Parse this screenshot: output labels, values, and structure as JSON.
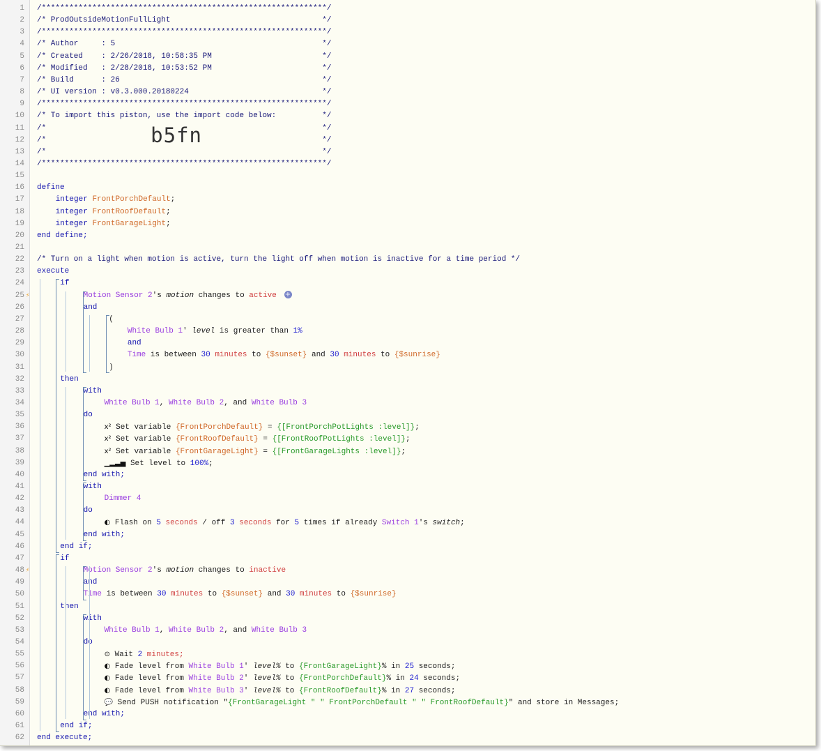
{
  "lines": [
    "/**************************************************************/",
    "/* ProdOutsideMotionFullLight                                 */",
    "/**************************************************************/",
    "/* Author     : 5                                             */",
    "/* Created    : 2/26/2018, 10:58:35 PM                        */",
    "/* Modified   : 2/28/2018, 10:53:52 PM                        */",
    "/* Build      : 26                                            */",
    "/* UI version : v0.3.000.20180224                             */",
    "/**************************************************************/",
    "/* To import this piston, use the import code below:          */",
    "/*                                                            */",
    "/*                                                            */",
    "/*                                                            */",
    "/**************************************************************/"
  ],
  "import_code": "b5fn",
  "keywords": {
    "define": "define",
    "integer": "integer",
    "end_define": "end define;",
    "execute": "execute",
    "if": "if",
    "and": "and",
    "then": "then",
    "with": "with",
    "do": "do",
    "end_with": "end with;",
    "end_if": "end if;",
    "end_execute": "end execute;"
  },
  "vars": {
    "v1": "FrontPorchDefault",
    "v2": "FrontRoofDefault",
    "v3": "FrontGarageLight"
  },
  "comment22": "/* Turn on a light when motion is active, turn the light off when motion is inactive for a time period */",
  "devices": {
    "motion": "Motion Sensor 2",
    "wb1": "White Bulb 1",
    "wb2": "White Bulb 2",
    "wb3": "White Bulb 3",
    "dimmer": "Dimmer 4",
    "switch": "Switch 1",
    "time": "Time"
  },
  "words": {
    "apos_s": "'s",
    "motion": "motion",
    "changes_to": "changes to",
    "active": "active",
    "inactive": "inactive",
    "paren_open": "(",
    "paren_close": ")",
    "apos": "'",
    "level": "level",
    "is_greater_than": "is greater than",
    "pct1": "1%",
    "is_between": "is between",
    "n30": "30",
    "minutes": "minutes",
    "to": "to",
    "sunset": "{$sunset}",
    "sunrise": "{$sunrise}",
    "comma": ",",
    "and_sep": ", and",
    "set_variable": "Set variable",
    "eq": "=",
    "semi": ";",
    "expr1": "{[FrontPorchPotLights :level]}",
    "expr2": "{[FrontRoofPotLights :level]}",
    "expr3": "{[FrontGarageLights :level]}",
    "set_level_to": "Set level to",
    "pct100": "100%",
    "flash_on": "Flash on",
    "n5": "5",
    "seconds": "seconds",
    "slash_off": "/ off",
    "n3": "3",
    "for": "for",
    "times_if_already": "times if already",
    "switch": "switch",
    "wait": "Wait",
    "n2": "2",
    "minutes_semi": "minutes;",
    "fade_from": "Fade level from",
    "level_pct": "level%",
    "in": "in",
    "seconds_semi": "seconds;",
    "n25": "25",
    "n24": "24",
    "n27": "27",
    "pct": "%",
    "v3_brace": "{FrontGarageLight}",
    "v1_brace": "{FrontPorchDefault}",
    "v2_brace": "{FrontRoofDefault}",
    "send_push": "Send PUSH notification",
    "q": "\"",
    "push_expr": "{FrontGarageLight \" \" FrontPorchDefault \" \" FrontRoofDefault}",
    "store": "and store in Messages;"
  },
  "icons": {
    "var": "x²",
    "level": "signal-bars-icon",
    "toggle": "toggle-icon",
    "clock": "clock-icon",
    "chat": "chat-bubble-icon",
    "trigger": "lightning-bolt-icon",
    "add": "plus-circle-icon"
  },
  "colors": {
    "background": "#fdfdf3",
    "keyword": "#1a1ab0",
    "device": "#9a3fe0",
    "variable": "#d06a2a",
    "number": "#2020d0",
    "green": "#2a9a2a",
    "string": "#d04040"
  }
}
